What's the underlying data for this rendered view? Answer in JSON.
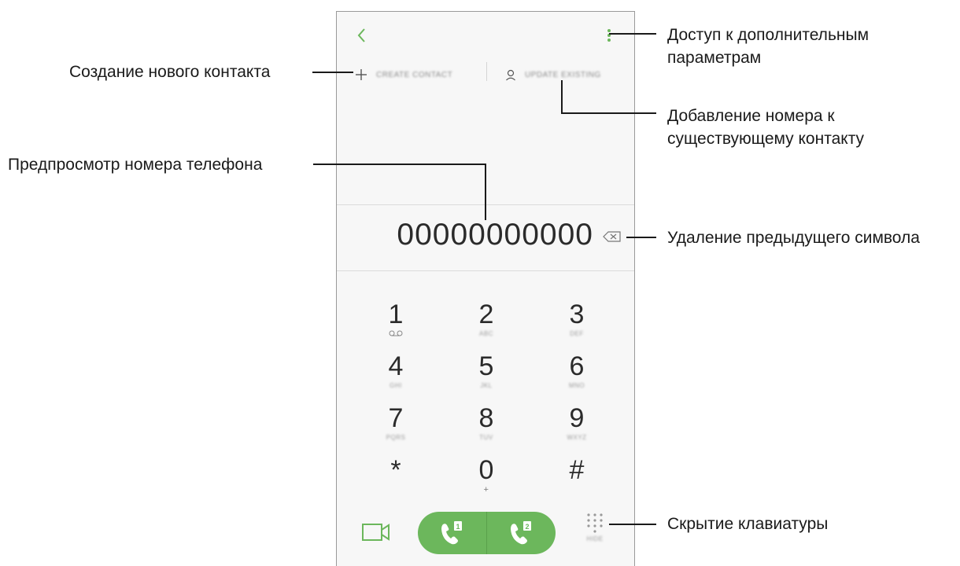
{
  "phone": {
    "create_contact_label": "CREATE CONTACT",
    "update_existing_label": "UPDATE EXISTING",
    "number": "00000000000",
    "keys": [
      {
        "digit": "1",
        "sub": ""
      },
      {
        "digit": "2",
        "sub": "ABC"
      },
      {
        "digit": "3",
        "sub": "DEF"
      },
      {
        "digit": "4",
        "sub": "GHI"
      },
      {
        "digit": "5",
        "sub": "JKL"
      },
      {
        "digit": "6",
        "sub": "MNO"
      },
      {
        "digit": "7",
        "sub": "PQRS"
      },
      {
        "digit": "8",
        "sub": "TUV"
      },
      {
        "digit": "9",
        "sub": "WXYZ"
      },
      {
        "digit": "*",
        "sub": ""
      },
      {
        "digit": "0",
        "sub": "+"
      },
      {
        "digit": "#",
        "sub": ""
      }
    ],
    "sim1_badge": "1",
    "sim2_badge": "2",
    "hide_keypad_label": "HIDE",
    "accent_color": "#6cb75c"
  },
  "callouts": {
    "more_options_line1": "Доступ к дополнительным",
    "more_options_line2": "параметрам",
    "create_contact": "Создание нового контакта",
    "add_to_existing_line1": "Добавление номера к",
    "add_to_existing_line2": "существующему контакту",
    "number_preview": "Предпросмотр номера телефона",
    "delete_previous": "Удаление предыдущего символа",
    "hide_keypad": "Скрытие клавиатуры"
  }
}
